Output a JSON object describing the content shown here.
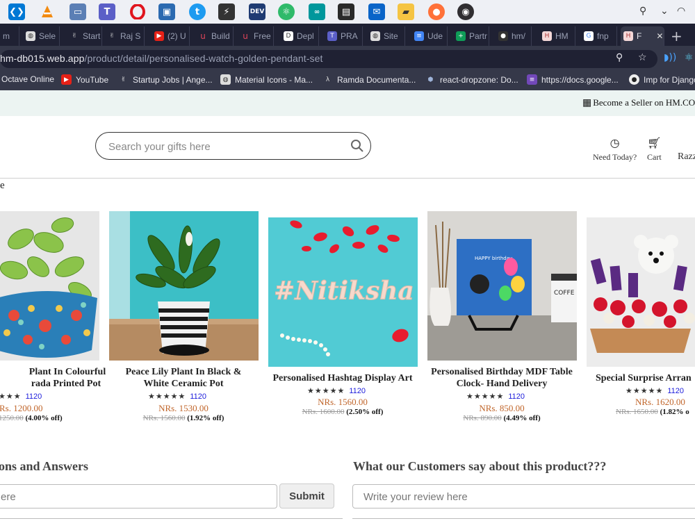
{
  "taskbar": {
    "icons": [
      "vscode-icon",
      "vlc-icon",
      "remote-desktop-icon",
      "teams-icon",
      "opera-icon",
      "virtualbox-icon",
      "twitter-icon",
      "terminal-icon",
      "dev-icon",
      "git-icon",
      "arduino-icon",
      "store-icon",
      "mail-icon",
      "explorer-icon",
      "firefox-icon",
      "obs-icon"
    ],
    "tray": [
      "person-icon",
      "chevron-icon",
      "wifi-icon"
    ]
  },
  "tabs": [
    {
      "label": "m",
      "icon": "generic-icon"
    },
    {
      "label": "Sele",
      "icon": "globe-icon"
    },
    {
      "label": "Start",
      "icon": "peace-icon"
    },
    {
      "label": "Raj S",
      "icon": "peace-icon"
    },
    {
      "label": "(2) U",
      "icon": "youtube-icon"
    },
    {
      "label": "Build",
      "icon": "u-icon"
    },
    {
      "label": "Free",
      "icon": "u-icon"
    },
    {
      "label": "Depl",
      "icon": "doc-icon"
    },
    {
      "label": "PRA",
      "icon": "teams-icon"
    },
    {
      "label": "Site",
      "icon": "globe-icon"
    },
    {
      "label": "Ude",
      "icon": "docs-icon"
    },
    {
      "label": "Partr",
      "icon": "sheets-icon"
    },
    {
      "label": "hm/",
      "icon": "github-icon"
    },
    {
      "label": "HM",
      "icon": "hm-icon"
    },
    {
      "label": "fnp",
      "icon": "google-icon"
    },
    {
      "label": "F",
      "icon": "hm-icon",
      "active": true
    }
  ],
  "address": {
    "url_main": "hm-db015.web.app",
    "url_path": "/product/detail/personalised-watch-golden-pendant-set"
  },
  "bookmarks": [
    {
      "label": "Octave Online",
      "icon": "octave-icon"
    },
    {
      "label": "YouTube",
      "icon": "youtube-icon"
    },
    {
      "label": "Startup Jobs | Ange...",
      "icon": "peace-icon"
    },
    {
      "label": "Material Icons - Ma...",
      "icon": "globe-icon"
    },
    {
      "label": "Ramda Documenta...",
      "icon": "ramda-icon"
    },
    {
      "label": "react-dropzone: Do...",
      "icon": "cube-icon"
    },
    {
      "label": "https://docs.google...",
      "icon": "forms-icon"
    },
    {
      "label": "Imp for Django",
      "icon": "github-icon"
    }
  ],
  "page": {
    "seller_link": "Become a Seller on HM.COM",
    "search_placeholder": "Search your gifts here",
    "need_today": "Need Today?",
    "cart": "Cart",
    "user": "Razz",
    "section_fragment": "e",
    "qa_title": "ons and Answers",
    "qa_placeholder": "ere",
    "submit": "Submit",
    "review_title": "What our Customers say about this product???",
    "review_placeholder": "Write your review here"
  },
  "products": [
    {
      "name1": "Plant In Colourful",
      "name2": "rada Printed Pot",
      "rating_count": "1120",
      "price": "Rs. 1200.00",
      "old_price": "1250.00",
      "off": "(4.00% off)"
    },
    {
      "name1": "Peace Lily Plant In Black &",
      "name2": "White Ceramic Pot",
      "rating_count": "1120",
      "price": "NRs. 1530.00",
      "old_price": "NRs. 1560.00",
      "off": "(1.92% off)"
    },
    {
      "name1": "Personalised Hashtag Display Art",
      "name2": "",
      "rating_count": "1120",
      "price": "NRs. 1560.00",
      "old_price": "NRs. 1600.00",
      "off": "(2.50% off)"
    },
    {
      "name1": "Personalised Birthday MDF Table",
      "name2": "Clock- Hand Delivery",
      "rating_count": "1120",
      "price": "NRs. 850.00",
      "old_price": "NRs. 890.00",
      "off": "(4.49% off)"
    },
    {
      "name1": "Special Surprise Arran",
      "name2": "",
      "rating_count": "1120",
      "price": "NRs. 1620.00",
      "old_price": "NRs. 1650.00",
      "off": "(1.82% o"
    }
  ],
  "image_text": {
    "hashtag": "#Nitiksha",
    "clock_text": "HAPPY birthday",
    "mug_text": "COFFE"
  },
  "colors": {
    "price": "#c0652a",
    "rating_count": "#1a1adb",
    "tabstrip": "#1f2133",
    "toolbar": "#353849"
  }
}
